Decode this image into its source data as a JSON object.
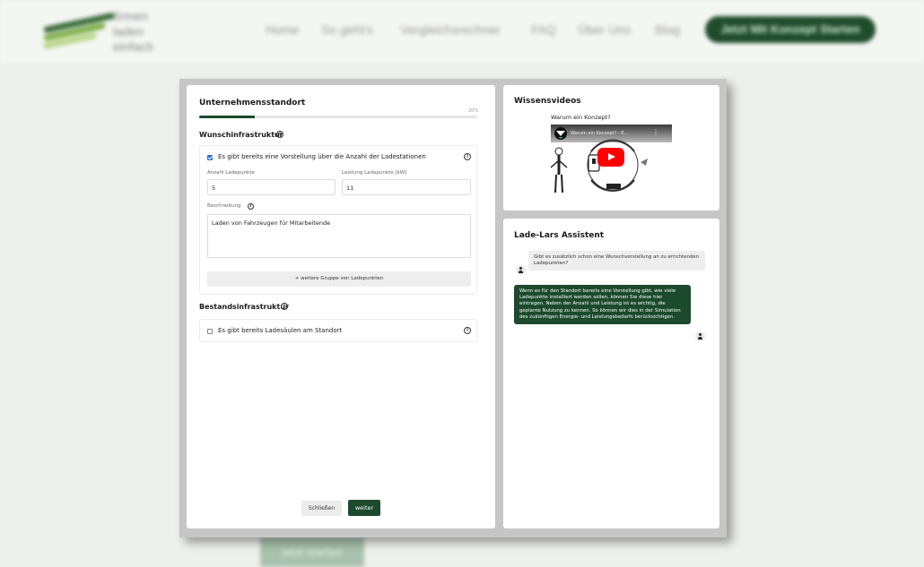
{
  "background": {
    "logo_lines": [
      "firmen",
      "laden",
      "einfach"
    ],
    "nav": [
      "Home",
      "So geht's",
      "Vergleichsrechner",
      "FAQ",
      "Über Uns",
      "Blog"
    ],
    "cta": "Jetzt Mit Konzept Starten",
    "bottom_button": "Jetzt starten"
  },
  "form": {
    "title": "Unternehmensstandort",
    "progress_label": "20%",
    "progress_value": 0.2,
    "wunsch": {
      "title": "Wunschinfrastruktur",
      "checkbox_label": "Es gibt bereits eine Vorstellung über die Anzahl der Ladestationen",
      "checked": true,
      "anzahl_label": "Anzahl Ladepunkte",
      "anzahl_value": "5",
      "leistung_label": "Leistung Ladepunkte [kW]",
      "leistung_value": "11",
      "beschreibung_label": "Beschreibung",
      "beschreibung_value": "Laden von Fahrzeugen für Mitarbeitende",
      "add_group": "+ weitere Gruppe von Ladepunkten"
    },
    "bestand": {
      "title": "Bestandsinfrastruktur",
      "checkbox_label": "Es gibt bereits Ladesäulen am Standort",
      "checked": false
    },
    "close_label": "Schließen",
    "next_label": "weiter"
  },
  "videos": {
    "title": "Wissensvideos",
    "caption": "Warum ein Konzept?",
    "video_title": "Warum ein Konzept? - E..."
  },
  "assistant": {
    "title": "Lade-Lars Assistent",
    "messages": [
      {
        "role": "bot",
        "text": "Gibt es zusätzlich schon eine Wunschvorstellung an zu errichtenden Ladepunkten?"
      },
      {
        "role": "user",
        "text": "Wenn es für den Standort bereits eine Vorstellung gibt, wie viele Ladepunkte installiert werden sollen, können Sie diese hier eintragen. Neben der Anzahl und Leistung ist es wichtig, die geplante Nutzung zu kennen. So können wir dies in der Simulation des zukünftigen Energie- und Leistungsbedarfs berücksichtigen."
      }
    ]
  },
  "colors": {
    "brand": "#1b4a2c",
    "checkbox": "#2a6fdb",
    "youtube": "#ff0000"
  }
}
